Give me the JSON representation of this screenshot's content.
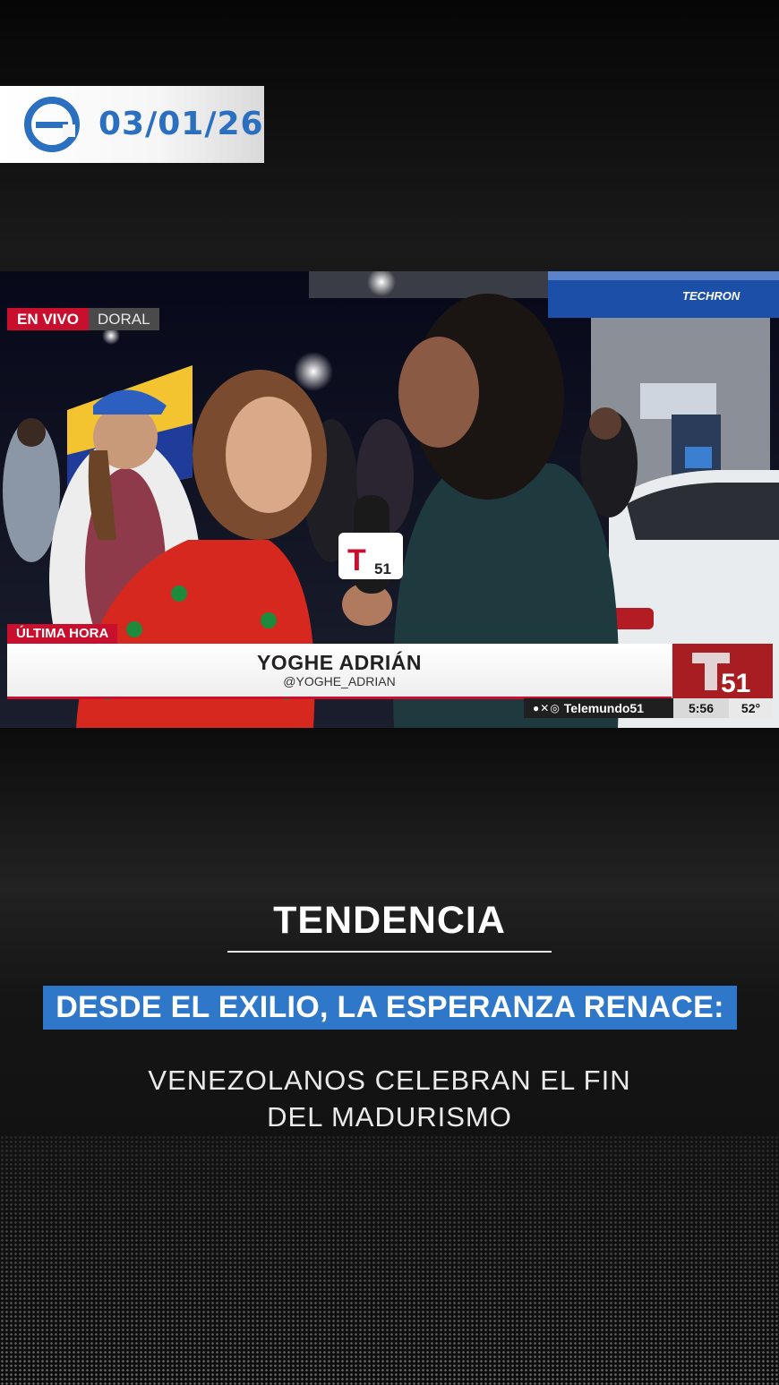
{
  "date_badge": {
    "date": "03/01/26",
    "logo_icon": "e-logo-icon",
    "accent_color": "#2a6fc0"
  },
  "broadcast": {
    "live_label": "EN VIVO",
    "location": "DORAL",
    "breaking_label": "ÚLTIMA HORA",
    "reporter_name": "YOGHE ADRIÁN",
    "reporter_handle": "@YOGHE_ADRIAN",
    "social_handle": "Telemundo51",
    "social_icons": [
      "facebook-icon",
      "x-icon",
      "instagram-icon"
    ],
    "time": "5:56",
    "temperature": "52°",
    "channel_logo_text": "51",
    "accent_color": "#c8102e"
  },
  "story": {
    "section_title": "TENDENCIA",
    "headline": "DESDE EL EXILIO, LA ESPERANZA RENACE:",
    "subheadline_line1": "VENEZOLANOS CELEBRAN EL FIN",
    "subheadline_line2": "DEL MADURISMO",
    "highlight_color": "#2f77c9"
  }
}
